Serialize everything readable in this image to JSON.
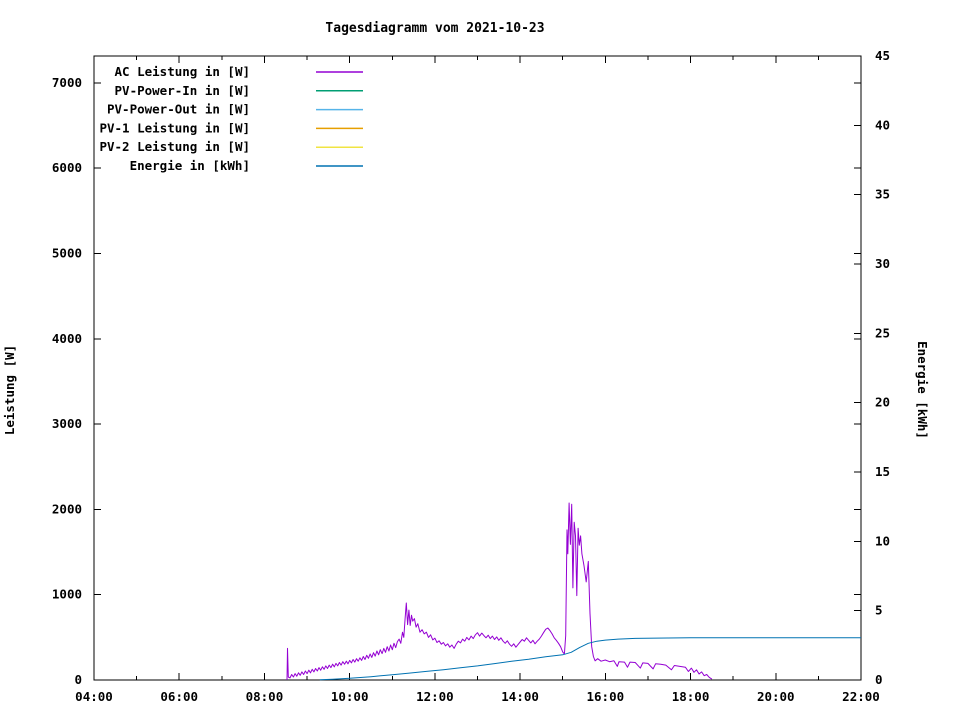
{
  "title": "Tagesdiagramm vom 2021-10-23",
  "chart_data": {
    "type": "line",
    "title": "Tagesdiagramm vom 2021-10-23",
    "x_axis": {
      "range": [
        4,
        22
      ],
      "major_ticks": [
        {
          "t": 4,
          "label": "04:00"
        },
        {
          "t": 6,
          "label": "06:00"
        },
        {
          "t": 8,
          "label": "08:00"
        },
        {
          "t": 10,
          "label": "10:00"
        },
        {
          "t": 12,
          "label": "12:00"
        },
        {
          "t": 14,
          "label": "14:00"
        },
        {
          "t": 16,
          "label": "16:00"
        },
        {
          "t": 18,
          "label": "18:00"
        },
        {
          "t": 20,
          "label": "20:00"
        },
        {
          "t": 22,
          "label": "22:00"
        }
      ],
      "minor_ticks": [
        5,
        7,
        9,
        11,
        13,
        15,
        17,
        19,
        21
      ]
    },
    "y_left": {
      "label": "Leistung [W]",
      "range": [
        0,
        7316
      ],
      "ticks": [
        {
          "v": 0,
          "label": "0"
        },
        {
          "v": 1000,
          "label": "1000"
        },
        {
          "v": 2000,
          "label": "2000"
        },
        {
          "v": 3000,
          "label": "3000"
        },
        {
          "v": 4000,
          "label": "4000"
        },
        {
          "v": 5000,
          "label": "5000"
        },
        {
          "v": 6000,
          "label": "6000"
        },
        {
          "v": 7000,
          "label": "7000"
        }
      ]
    },
    "y_right": {
      "label": "Energie [kWh]",
      "range": [
        0,
        45
      ],
      "ticks": [
        {
          "v": 0,
          "label": "0"
        },
        {
          "v": 5,
          "label": "5"
        },
        {
          "v": 10,
          "label": "10"
        },
        {
          "v": 15,
          "label": "15"
        },
        {
          "v": 20,
          "label": "20"
        },
        {
          "v": 25,
          "label": "25"
        },
        {
          "v": 30,
          "label": "30"
        },
        {
          "v": 35,
          "label": "35"
        },
        {
          "v": 40,
          "label": "40"
        },
        {
          "v": 45,
          "label": "45"
        }
      ]
    },
    "legend": [
      {
        "label": "AC Leistung in [W]",
        "color": "#9400d3"
      },
      {
        "label": "PV-Power-In in [W]",
        "color": "#009e73"
      },
      {
        "label": "PV-Power-Out in [W]",
        "color": "#56b4e9"
      },
      {
        "label": "PV-1 Leistung in [W]",
        "color": "#e69f00"
      },
      {
        "label": "PV-2 Leistung in [W]",
        "color": "#f0e442"
      },
      {
        "label": "Energie in [kWh]",
        "color": "#0072b2"
      }
    ],
    "series": [
      {
        "name": "AC Leistung in [W]",
        "color": "#9400d3",
        "axis": "left",
        "points": [
          [
            8.53,
            0
          ],
          [
            8.54,
            370
          ],
          [
            8.56,
            35
          ],
          [
            8.6,
            25
          ],
          [
            8.64,
            65
          ],
          [
            8.68,
            35
          ],
          [
            8.72,
            75
          ],
          [
            8.76,
            45
          ],
          [
            8.8,
            85
          ],
          [
            8.84,
            55
          ],
          [
            8.88,
            95
          ],
          [
            8.92,
            65
          ],
          [
            8.96,
            105
          ],
          [
            9.0,
            75
          ],
          [
            9.04,
            115
          ],
          [
            9.08,
            85
          ],
          [
            9.12,
            125
          ],
          [
            9.16,
            95
          ],
          [
            9.2,
            135
          ],
          [
            9.24,
            105
          ],
          [
            9.28,
            145
          ],
          [
            9.32,
            115
          ],
          [
            9.36,
            155
          ],
          [
            9.4,
            125
          ],
          [
            9.44,
            165
          ],
          [
            9.48,
            135
          ],
          [
            9.52,
            175
          ],
          [
            9.56,
            145
          ],
          [
            9.6,
            185
          ],
          [
            9.64,
            155
          ],
          [
            9.68,
            195
          ],
          [
            9.72,
            165
          ],
          [
            9.76,
            205
          ],
          [
            9.8,
            175
          ],
          [
            9.84,
            215
          ],
          [
            9.88,
            185
          ],
          [
            9.92,
            220
          ],
          [
            9.96,
            190
          ],
          [
            10.0,
            230
          ],
          [
            10.04,
            200
          ],
          [
            10.08,
            240
          ],
          [
            10.12,
            210
          ],
          [
            10.16,
            250
          ],
          [
            10.2,
            220
          ],
          [
            10.24,
            260
          ],
          [
            10.28,
            230
          ],
          [
            10.32,
            275
          ],
          [
            10.36,
            240
          ],
          [
            10.4,
            290
          ],
          [
            10.44,
            255
          ],
          [
            10.48,
            305
          ],
          [
            10.52,
            265
          ],
          [
            10.56,
            320
          ],
          [
            10.6,
            280
          ],
          [
            10.64,
            340
          ],
          [
            10.68,
            295
          ],
          [
            10.72,
            355
          ],
          [
            10.76,
            310
          ],
          [
            10.8,
            370
          ],
          [
            10.84,
            325
          ],
          [
            10.88,
            390
          ],
          [
            10.92,
            340
          ],
          [
            10.96,
            410
          ],
          [
            11.0,
            355
          ],
          [
            11.04,
            430
          ],
          [
            11.08,
            380
          ],
          [
            11.12,
            450
          ],
          [
            11.16,
            480
          ],
          [
            11.2,
            430
          ],
          [
            11.24,
            560
          ],
          [
            11.27,
            500
          ],
          [
            11.3,
            720
          ],
          [
            11.33,
            903
          ],
          [
            11.36,
            650
          ],
          [
            11.39,
            820
          ],
          [
            11.42,
            640
          ],
          [
            11.45,
            760
          ],
          [
            11.48,
            690
          ],
          [
            11.52,
            720
          ],
          [
            11.56,
            620
          ],
          [
            11.6,
            660
          ],
          [
            11.65,
            560
          ],
          [
            11.7,
            590
          ],
          [
            11.75,
            540
          ],
          [
            11.8,
            560
          ],
          [
            11.85,
            500
          ],
          [
            11.9,
            530
          ],
          [
            11.95,
            470
          ],
          [
            12.0,
            490
          ],
          [
            12.05,
            440
          ],
          [
            12.1,
            460
          ],
          [
            12.15,
            420
          ],
          [
            12.2,
            440
          ],
          [
            12.25,
            400
          ],
          [
            12.3,
            425
          ],
          [
            12.35,
            385
          ],
          [
            12.4,
            410
          ],
          [
            12.45,
            370
          ],
          [
            12.5,
            420
          ],
          [
            12.55,
            455
          ],
          [
            12.6,
            435
          ],
          [
            12.65,
            480
          ],
          [
            12.7,
            455
          ],
          [
            12.75,
            500
          ],
          [
            12.8,
            470
          ],
          [
            12.85,
            515
          ],
          [
            12.9,
            485
          ],
          [
            12.95,
            530
          ],
          [
            13.0,
            555
          ],
          [
            13.05,
            515
          ],
          [
            13.1,
            550
          ],
          [
            13.15,
            520
          ],
          [
            13.2,
            495
          ],
          [
            13.25,
            525
          ],
          [
            13.3,
            485
          ],
          [
            13.35,
            515
          ],
          [
            13.4,
            475
          ],
          [
            13.45,
            505
          ],
          [
            13.5,
            465
          ],
          [
            13.55,
            495
          ],
          [
            13.6,
            455
          ],
          [
            13.65,
            430
          ],
          [
            13.7,
            460
          ],
          [
            13.75,
            420
          ],
          [
            13.8,
            395
          ],
          [
            13.85,
            425
          ],
          [
            13.9,
            385
          ],
          [
            13.95,
            415
          ],
          [
            14.0,
            445
          ],
          [
            14.05,
            475
          ],
          [
            14.1,
            455
          ],
          [
            14.15,
            495
          ],
          [
            14.2,
            465
          ],
          [
            14.25,
            435
          ],
          [
            14.3,
            465
          ],
          [
            14.35,
            425
          ],
          [
            14.4,
            455
          ],
          [
            14.45,
            480
          ],
          [
            14.5,
            515
          ],
          [
            14.55,
            555
          ],
          [
            14.6,
            595
          ],
          [
            14.65,
            610
          ],
          [
            14.7,
            580
          ],
          [
            14.75,
            540
          ],
          [
            14.8,
            495
          ],
          [
            14.85,
            465
          ],
          [
            14.9,
            430
          ],
          [
            14.95,
            390
          ],
          [
            15.0,
            330
          ],
          [
            15.04,
            305
          ],
          [
            15.07,
            520
          ],
          [
            15.1,
            1760
          ],
          [
            15.12,
            1480
          ],
          [
            15.15,
            2075
          ],
          [
            15.18,
            1590
          ],
          [
            15.21,
            2060
          ],
          [
            15.24,
            1080
          ],
          [
            15.27,
            1850
          ],
          [
            15.3,
            1690
          ],
          [
            15.33,
            990
          ],
          [
            15.36,
            1780
          ],
          [
            15.39,
            1580
          ],
          [
            15.42,
            1690
          ],
          [
            15.45,
            1480
          ],
          [
            15.5,
            1340
          ],
          [
            15.55,
            1150
          ],
          [
            15.6,
            1390
          ],
          [
            15.64,
            780
          ],
          [
            15.68,
            390
          ],
          [
            15.72,
            275
          ],
          [
            15.76,
            225
          ],
          [
            15.82,
            250
          ],
          [
            15.9,
            220
          ],
          [
            16.0,
            235
          ],
          [
            16.1,
            215
          ],
          [
            16.2,
            225
          ],
          [
            16.28,
            160
          ],
          [
            16.32,
            215
          ],
          [
            16.45,
            210
          ],
          [
            16.52,
            150
          ],
          [
            16.58,
            210
          ],
          [
            16.7,
            205
          ],
          [
            16.82,
            140
          ],
          [
            16.88,
            200
          ],
          [
            17.0,
            195
          ],
          [
            17.12,
            130
          ],
          [
            17.18,
            190
          ],
          [
            17.3,
            185
          ],
          [
            17.42,
            175
          ],
          [
            17.55,
            120
          ],
          [
            17.62,
            170
          ],
          [
            17.75,
            160
          ],
          [
            17.88,
            150
          ],
          [
            17.95,
            100
          ],
          [
            18.02,
            140
          ],
          [
            18.08,
            90
          ],
          [
            18.14,
            120
          ],
          [
            18.2,
            70
          ],
          [
            18.26,
            95
          ],
          [
            18.32,
            50
          ],
          [
            18.38,
            65
          ],
          [
            18.44,
            30
          ],
          [
            18.5,
            10
          ]
        ]
      },
      {
        "name": "PV-Power-In in [W]",
        "color": "#009e73",
        "axis": "left",
        "points": []
      },
      {
        "name": "PV-Power-Out in [W]",
        "color": "#56b4e9",
        "axis": "left",
        "points": []
      },
      {
        "name": "PV-1 Leistung in [W]",
        "color": "#e69f00",
        "axis": "left",
        "points": []
      },
      {
        "name": "PV-2 Leistung in [W]",
        "color": "#f0e442",
        "axis": "left",
        "points": []
      },
      {
        "name": "Energie in [kWh]",
        "color": "#0072b2",
        "axis": "right",
        "points": [
          [
            9.3,
            0.02
          ],
          [
            9.6,
            0.06
          ],
          [
            10.0,
            0.12
          ],
          [
            10.5,
            0.24
          ],
          [
            11.0,
            0.38
          ],
          [
            11.4,
            0.5
          ],
          [
            11.8,
            0.62
          ],
          [
            12.2,
            0.74
          ],
          [
            12.6,
            0.88
          ],
          [
            13.0,
            1.02
          ],
          [
            13.4,
            1.18
          ],
          [
            13.8,
            1.35
          ],
          [
            14.2,
            1.5
          ],
          [
            14.6,
            1.68
          ],
          [
            15.0,
            1.82
          ],
          [
            15.2,
            2.0
          ],
          [
            15.4,
            2.35
          ],
          [
            15.6,
            2.65
          ],
          [
            15.8,
            2.8
          ],
          [
            16.0,
            2.88
          ],
          [
            16.3,
            2.95
          ],
          [
            16.7,
            3.0
          ],
          [
            17.2,
            3.02
          ],
          [
            18.0,
            3.04
          ],
          [
            19.0,
            3.05
          ],
          [
            22.0,
            3.05
          ]
        ]
      }
    ],
    "layout": {
      "grid": false,
      "legend_position": "top-left-inside",
      "background": "#ffffff",
      "border_color": "#000000"
    }
  }
}
